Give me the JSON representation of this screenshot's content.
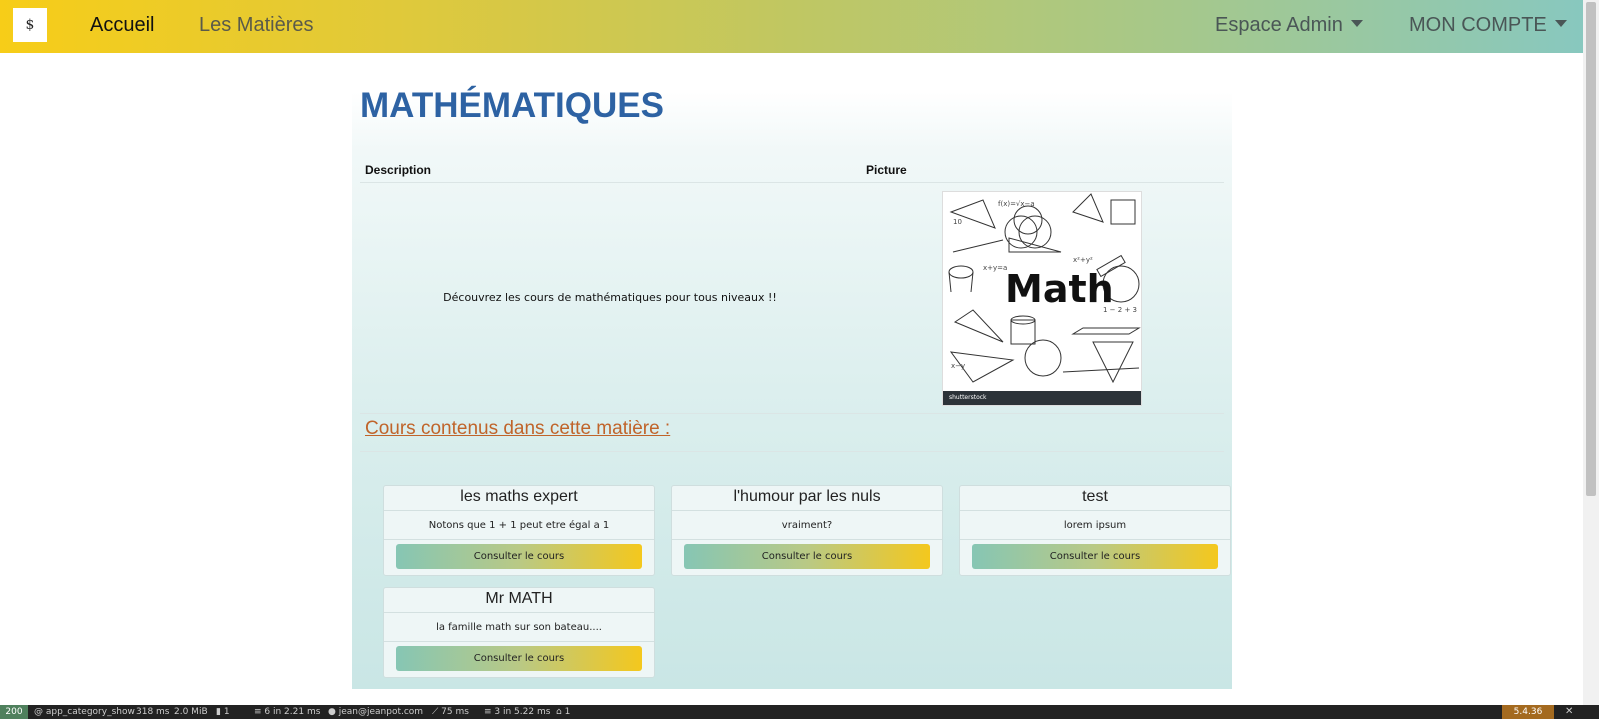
{
  "navbar": {
    "brand": "$",
    "home": "Accueil",
    "matieres": "Les Matières",
    "admin": "Espace Admin",
    "account": "MON COMPTE"
  },
  "page": {
    "title": "MATHÉMATIQUES",
    "col_description": "Description",
    "col_picture": "Picture",
    "description": "Découvrez les cours de mathématiques pour tous niveaux !!",
    "image_word": "Math",
    "image_footer": "shutterstock",
    "section_title": "Cours contenus dans cette matière :"
  },
  "courses": [
    {
      "title": "les maths expert",
      "text": "Notons que 1 + 1 peut etre égal a 1",
      "button": "Consulter le cours"
    },
    {
      "title": "l'humour par les nuls",
      "text": "vraiment?",
      "button": "Consulter le cours"
    },
    {
      "title": "test",
      "text": "lorem ipsum",
      "button": "Consulter le cours"
    },
    {
      "title": "Mr MATH",
      "text": "la famille math sur son bateau....",
      "button": "Consulter le cours"
    }
  ],
  "toolbar": {
    "status": "200",
    "route": "@ app_category_show",
    "time": "318 ms",
    "memory": "2.0 MiB",
    "forms": "1",
    "db": "6 in 2.21 ms",
    "user": "jean@jeanpot.com",
    "ajax": "75 ms",
    "cache": "3 in 5.22 ms",
    "twig": "1",
    "version": "5.4.36",
    "close": "✕"
  }
}
